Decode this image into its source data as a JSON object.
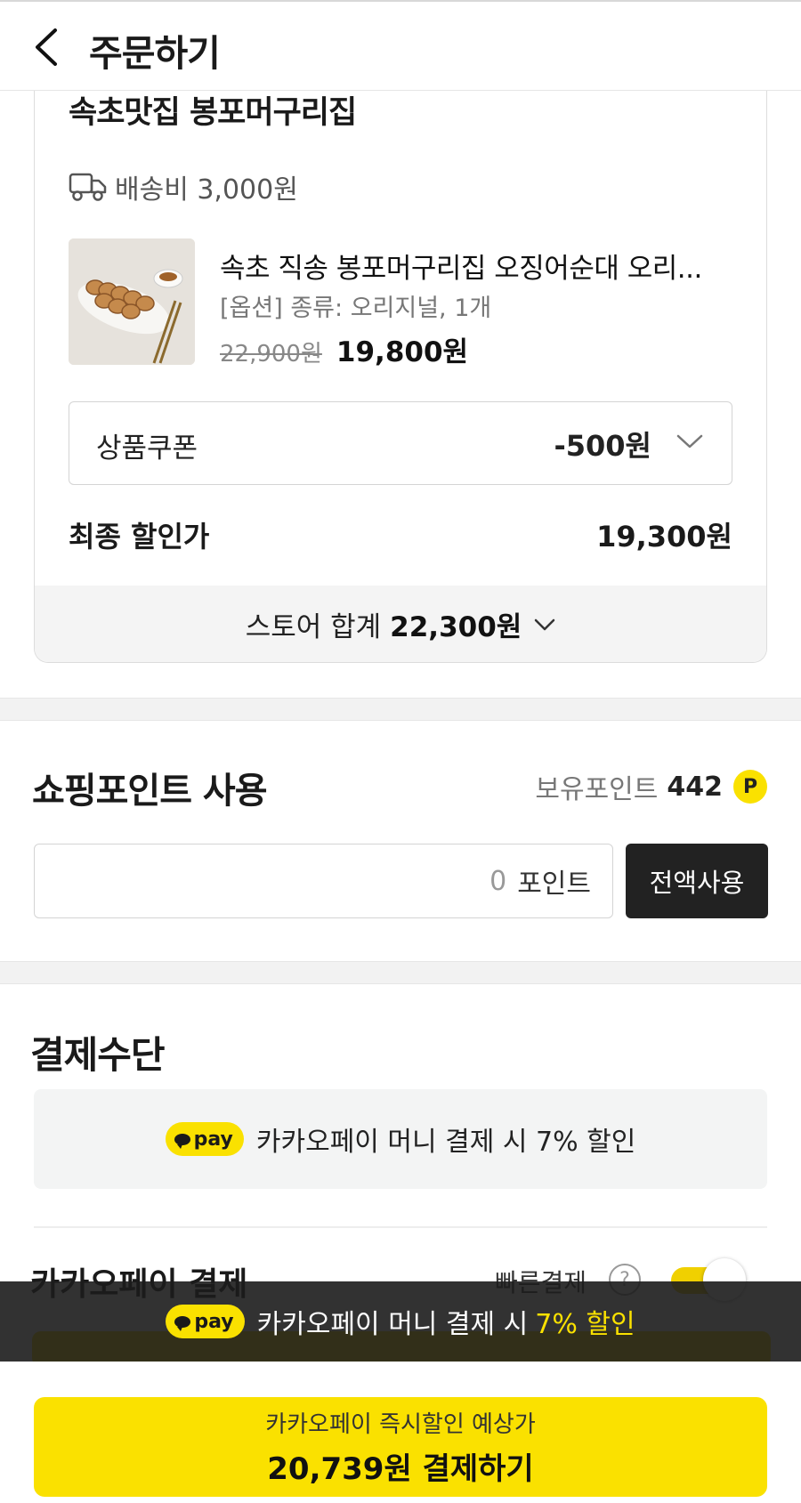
{
  "header": {
    "title": "주문하기"
  },
  "store": {
    "name": "속초맛집 봉포머구리집",
    "shipping": "배송비 3,000원",
    "product": {
      "name": "속초 직송 봉포머구리집 오징어순대 오리...",
      "option": "[옵션] 종류: 오리지널, 1개",
      "price_original": "22,900원",
      "price_sale": "19,800원"
    },
    "coupon": {
      "label": "상품쿠폰",
      "value": "-500원"
    },
    "final": {
      "label": "최종 할인가",
      "value": "19,300원"
    },
    "total": {
      "label": "스토어 합계",
      "value": "22,300원"
    }
  },
  "points": {
    "title": "쇼핑포인트 사용",
    "owned_label": "보유포인트",
    "owned_value": "442",
    "icon_letter": "P",
    "input_value": "0",
    "input_unit": "포인트",
    "use_all": "전액사용"
  },
  "payment": {
    "title": "결제수단",
    "promo_badge": "pay",
    "promo_text": "카카오페이 머니 결제 시 7% 할인",
    "method_label": "카카오페이 결제",
    "fast_pay_label": "빠른결제",
    "help_symbol": "?",
    "fast_pay_enabled": true
  },
  "toast": {
    "badge": "pay",
    "text": "카카오페이 머니 결제 시",
    "accent": "7% 할인"
  },
  "bottom": {
    "sub": "카카오페이 즉시할인 예상가",
    "main": "20,739원 결제하기"
  },
  "colors": {
    "kakao_yellow": "#fae100",
    "dark": "#222222"
  }
}
